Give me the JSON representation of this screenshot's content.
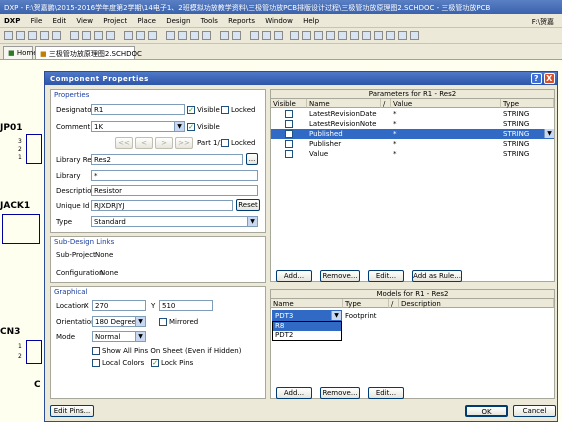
{
  "window": {
    "title": "DXP - F:\\贺嘉鹏\\2015-2016学年度第2学期\\14电子1、2班模拟功放教学资料\\三极管功放PCB排版设计过程\\三极管功放原理图2.SCHDOC - 三极管功放PCB"
  },
  "menu": {
    "items": [
      "DXP",
      "File",
      "Edit",
      "View",
      "Project",
      "Place",
      "Design",
      "Tools",
      "Reports",
      "Window",
      "Help"
    ],
    "path_hint": "F:\\贺嘉"
  },
  "tabs": [
    {
      "label": "Home"
    },
    {
      "label": "三极管功放原理图2.SCHDOC"
    }
  ],
  "schematic": {
    "labels": [
      "JP01",
      "3",
      "2",
      "1",
      "JACK1",
      "CN3",
      "1",
      "2",
      "C"
    ]
  },
  "dialog": {
    "title": "Component Properties",
    "help_btn": "?",
    "close_btn": "X",
    "properties": {
      "header": "Properties",
      "designator_label": "Designator",
      "designator_value": "R1",
      "designator_visible": "Visible",
      "designator_locked": "Locked",
      "comment_label": "Comment",
      "comment_value": "1K",
      "comment_visible": "Visible",
      "nav_buttons": [
        "<<",
        "<",
        ">",
        ">>"
      ],
      "part_label": "Part 1/1",
      "part_locked": "Locked",
      "libref_label": "Library Ref",
      "libref_value": "Res2",
      "libref_browse": "...",
      "library_label": "Library",
      "library_value": "*",
      "description_label": "Description",
      "description_value": "Resistor",
      "uniqueid_label": "Unique Id",
      "uniqueid_value": "RJXDRJYJ",
      "reset_button": "Reset",
      "type_label": "Type",
      "type_value": "Standard"
    },
    "subdesign": {
      "header": "Sub-Design Links",
      "subproject_label": "Sub-Project",
      "subproject_value": "None",
      "configuration_label": "Configuration",
      "configuration_value": "None"
    },
    "graphical": {
      "header": "Graphical",
      "location_label": "Location",
      "x_label": "X",
      "x_value": "270",
      "y_label": "Y",
      "y_value": "510",
      "orientation_label": "Orientation",
      "orientation_value": "180 Degrees",
      "mirrored_label": "Mirrored",
      "mode_label": "Mode",
      "mode_value": "Normal",
      "show_all_pins": "Show All Pins On Sheet (Even if Hidden)",
      "local_colors": "Local Colors",
      "lock_pins": "Lock Pins"
    },
    "parameters": {
      "title": "Parameters for R1 - Res2",
      "columns": [
        "Visible",
        "Name",
        "/",
        "Value",
        "Type"
      ],
      "rows": [
        {
          "name": "LatestRevisionDate",
          "value": "*",
          "type": "STRING",
          "selected": false
        },
        {
          "name": "LatestRevisionNote",
          "value": "*",
          "type": "STRING",
          "selected": false
        },
        {
          "name": "Published",
          "value": "*",
          "type": "STRING",
          "selected": true
        },
        {
          "name": "Publisher",
          "value": "*",
          "type": "STRING",
          "selected": false
        },
        {
          "name": "Value",
          "value": "*",
          "type": "STRING",
          "selected": false
        }
      ],
      "buttons": [
        "Add...",
        "Remove...",
        "Edit...",
        "Add as Rule..."
      ]
    },
    "models": {
      "title": "Models for R1 - Res2",
      "columns": [
        "Name",
        "Type",
        "/",
        "Description"
      ],
      "selected_name": "PDT3",
      "selected_type": "Footprint",
      "dropdown_options": [
        "R8",
        "PDT2"
      ],
      "buttons": [
        "Add...",
        "Remove...",
        "Edit..."
      ]
    },
    "footer": {
      "edit_pins": "Edit Pins...",
      "ok": "OK",
      "cancel": "Cancel"
    }
  }
}
